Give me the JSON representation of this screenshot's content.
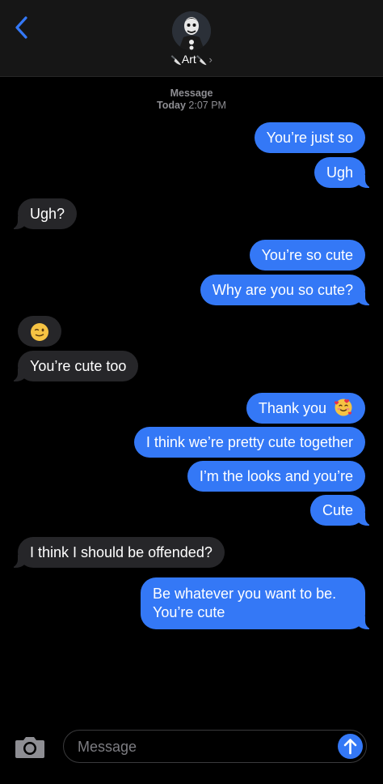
{
  "header": {
    "contact_name": "Art",
    "knife_left": "🔪",
    "knife_right": "🔪",
    "chevron": "›"
  },
  "meta": {
    "service": "Message",
    "day": "Today",
    "time": "2:07 PM"
  },
  "messages": [
    {
      "dir": "out",
      "text": "You’re just so"
    },
    {
      "dir": "out",
      "text": "Ugh"
    },
    {
      "dir": "in",
      "text": "Ugh?"
    },
    {
      "dir": "out",
      "text": "You’re so cute"
    },
    {
      "dir": "out",
      "text": "Why are you so cute?"
    },
    {
      "dir": "in",
      "text": "😉",
      "icon": "winking-face-emoji"
    },
    {
      "dir": "in",
      "text": "You’re cute too"
    },
    {
      "dir": "out",
      "text": "Thank you",
      "icon": "smiling-face-with-hearts-emoji"
    },
    {
      "dir": "out",
      "text": "I think we’re pretty cute together"
    },
    {
      "dir": "out",
      "text": "I’m the looks and you’re"
    },
    {
      "dir": "out",
      "text": "Cute"
    },
    {
      "dir": "in",
      "text": "I think I should be offended?"
    },
    {
      "dir": "out",
      "text": "Be whatever you want to be. You’re cute"
    }
  ],
  "composer": {
    "placeholder": "Message",
    "camera_icon": "camera-icon",
    "send_icon": "arrow-up-icon"
  },
  "colors": {
    "outgoing_bubble": "#3478f6",
    "incoming_bubble": "#262629",
    "background": "#000000",
    "header_bg": "#161616"
  }
}
